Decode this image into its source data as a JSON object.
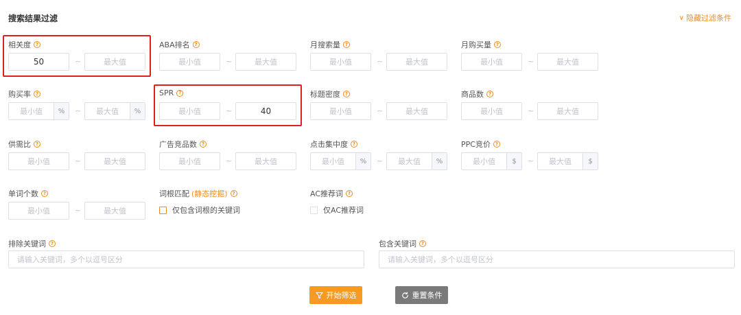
{
  "header": {
    "title": "搜索结果过滤",
    "toggle_label": "隐藏过滤条件"
  },
  "placeholders": {
    "min": "最小值",
    "max": "最大值",
    "tilde": "~",
    "percent": "%",
    "dollar": "$",
    "help": "?"
  },
  "fields": {
    "relevance": {
      "label": "相关度",
      "min_value": "50"
    },
    "aba_rank": {
      "label": "ABA排名"
    },
    "monthly_search": {
      "label": "月搜索量"
    },
    "monthly_purchase": {
      "label": "月购买量"
    },
    "purchase_rate": {
      "label": "购买率"
    },
    "spr": {
      "label": "SPR",
      "max_value": "40"
    },
    "title_density": {
      "label": "标题密度"
    },
    "product_count": {
      "label": "商品数"
    },
    "supply_demand": {
      "label": "供需比"
    },
    "ad_products": {
      "label": "广告竞品数"
    },
    "click_concentration": {
      "label": "点击集中度"
    },
    "ppc_bid": {
      "label": "PPC竞价"
    },
    "word_count": {
      "label": "单词个数"
    },
    "root_match": {
      "label": "词根匹配",
      "link": "(静态挖掘)",
      "checkbox_label": "仅包含词根的关键词"
    },
    "ac_recommend": {
      "label": "AC推荐词",
      "checkbox_label": "仅AC推荐词"
    }
  },
  "keywords": {
    "exclude_label": "排除关键词",
    "include_label": "包含关键词",
    "placeholder": "请输入关键词，多个以逗号区分"
  },
  "buttons": {
    "filter": "开始筛选",
    "reset": "重置条件"
  },
  "colors": {
    "accent": "#f08c1e",
    "highlight": "#e0201c",
    "primary_button": "#f59a23",
    "secondary_button": "#7a7a7a"
  }
}
